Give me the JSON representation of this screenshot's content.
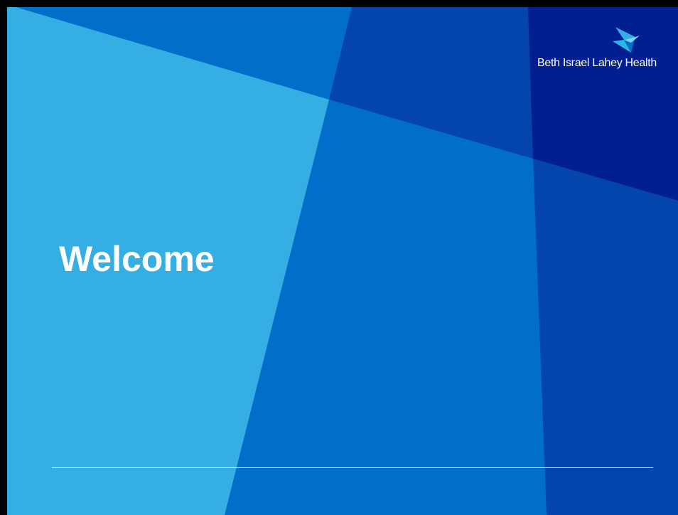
{
  "slide": {
    "title": "Welcome"
  },
  "logo": {
    "text": "Beth Israel Lahey Health",
    "icon": "bird-arrow-icon"
  },
  "colors": {
    "light_blue": "#35AFE3",
    "mid_blue": "#016FCA",
    "royal_blue": "#0344AD",
    "navy": "#021F91",
    "frame": "#000000",
    "text": "#FFFFFF"
  }
}
